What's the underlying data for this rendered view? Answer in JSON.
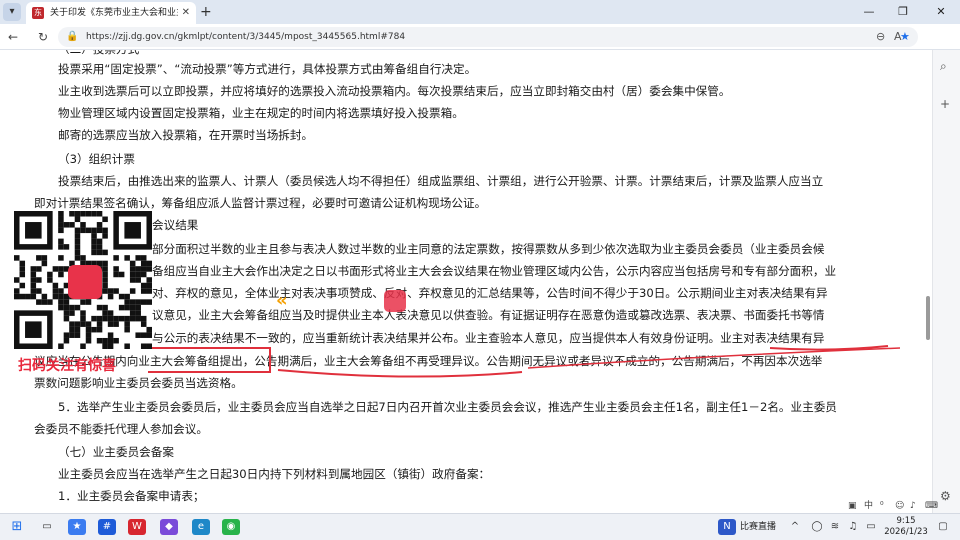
{
  "browser": {
    "tab_title": "关于印发《东莞市业主大会和业主",
    "url": "https://zjj.dg.gov.cn/gkmlpt/content/3/3445/mpost_3445565.html#784"
  },
  "document": {
    "lines": [
      "（二）投票方式",
      "投票采用“固定投票”、“流动投票”等方式进行，具体投票方式由筹备组自行决定。",
      "业主收到选票后可以立即投票，并应将填好的选票投入流动投票箱内。每次投票结束后，应当立即封箱交由村（居）委会集中保管。",
      "物业管理区域内设置固定投票箱，业主在规定的时间内将选票填好投入投票箱。",
      "邮寄的选票应当放入投票箱，在开票时当场拆封。",
      "（3）组织计票",
      "投票结束后，由推选出来的监票人、计票人（委员候选人均不得担任）组成监票组、计票组，进行公开验票、计票。计票结束后，计票及监票人应当立",
      "即对计票结果签名确认，筹备组应派人监督计票过程，必要时可邀请公证机构现场公证。",
      "会议结果",
      "部分面积过半数的业主且参与表决人数过半数的业主同意的法定票数，按得票数从多到少依次选取为业主委员会委员（业主委员会候",
      "备组应当自业主大会作出决定之日以书面形式将业主大会会议结果在物业管理区域内公告，公示内容应当包括房号和专有部分面积，业",
      "对、弃权的意见，全体业主对表决事项赞成、反对、弃权意见的汇总结果等，公告时间不得少于30日。公示期间业主对表决结果有异",
      "议意见，业主大会筹备组应当及时提供业主本人表决意见以供查验。有证据证明存在恶意伪造或篡改选票、表决票、书面委托书等情",
      "与公示的表决结果不一致的，应当重新统计表决结果并公布。业主查验本人意见，应当提供本人有效身份证明。业主对表决结果有异",
      "议应当在公告期内向业主大会筹备组提出，公告期满后，业主大会筹备组不再受理异议。公告期间无异议或者异议不成立的，公告期满后，不再因本次选举",
      "票数问题影响业主委员会委员当选资格。",
      "5．选举产生业主委员会委员后，业主委员会应当自选举之日起7日内召开首次业主委员会会议，推选产生业主委员会主任1名，副主任1－2名。业主委员",
      "会委员不能委托代理人参加会议。",
      "（七）业主委员会备案",
      "业主委员会应当在选举产生之日起30日内持下列材料到属地园区（镇街）政府备案：",
      "1．业主委员会备案申请表；"
    ]
  },
  "overlay": {
    "qr_caption": "扫码关注有惊喜"
  },
  "taskbar": {
    "news_label": "比赛直播",
    "time": "9:15",
    "date": "2026/1/23",
    "ime_label": "中"
  },
  "colors": {
    "annotation_red": "#e0303c",
    "accent": "#1f6feb"
  }
}
